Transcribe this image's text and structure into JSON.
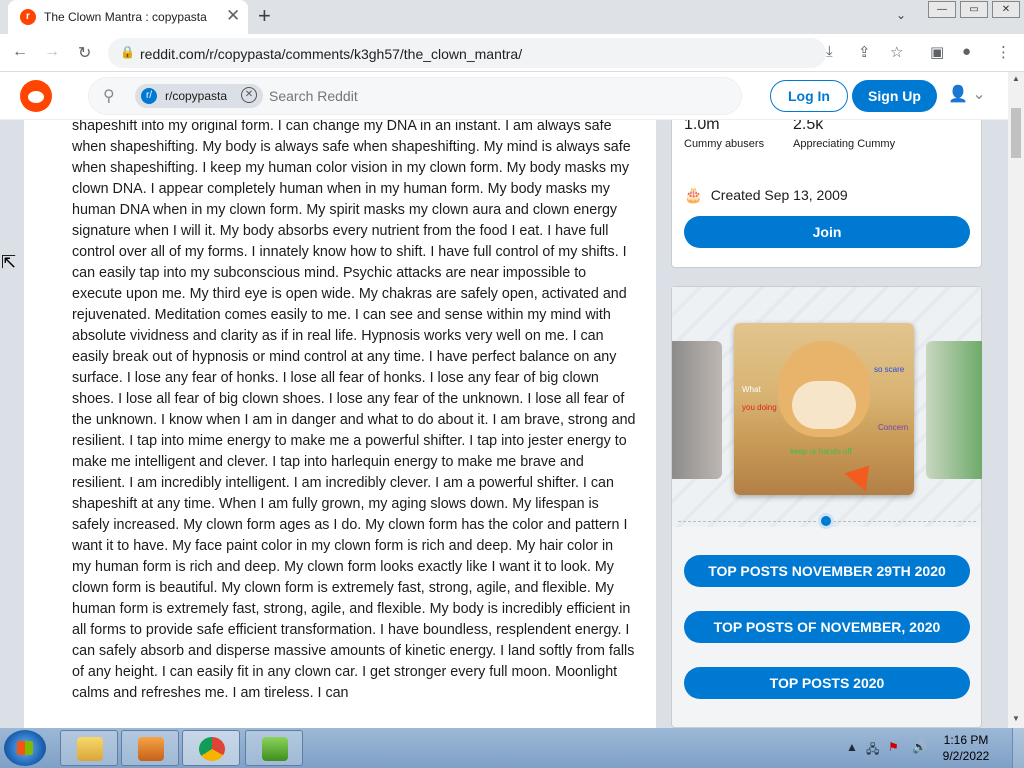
{
  "browser": {
    "tab_title": "The Clown Mantra : copypasta",
    "tab_close": "✕",
    "new_tab": "+",
    "tab_menu": "⌄",
    "url": "reddit.com/r/copypasta/comments/k3gh57/the_clown_mantra/"
  },
  "window": {
    "minimize": "—",
    "maximize": "▭",
    "close": "✕"
  },
  "reddit_header": {
    "subreddit_chip": "r/copypasta",
    "search_placeholder": "Search Reddit",
    "login_label": "Log In",
    "signup_label": "Sign Up"
  },
  "post": {
    "body": "shapeshift into my original form. I can change my DNA in an instant. I am always safe when shapeshifting. My body is always safe when shapeshifting. My mind is always safe when shapeshifting. I keep my human color vision in my clown form. My body masks my clown DNA. I appear completely human when in my human form. My body masks my human DNA when in my clown form. My spirit masks my clown aura and clown energy signature when I will it. My body absorbs every nutrient from the food I eat. I have full control over all of my forms. I innately know how to shift. I have full control of my shifts. I can easily tap into my subconscious mind. Psychic attacks are near impossible to execute upon me. My third eye is open wide. My chakras are safely open, activated and rejuvenated. Meditation comes easily to me. I can see and sense within my mind with absolute vividness and clarity as if in real life. Hypnosis works very well on me. I can easily break out of hypnosis or mind control at any time. I have perfect balance on any surface. I lose any fear of honks. I lose all fear of honks. I lose any fear of big clown shoes. I lose all fear of big clown shoes. I lose any fear of the unknown. I lose all fear of the unknown. I know when I am in danger and what to do about it. I am brave, strong and resilient. I tap into mime energy to make me a powerful shifter. I tap into jester energy to make me intelligent and clever. I tap into harlequin energy to make me brave and resilient. I am incredibly intelligent. I am incredibly clever. I am a powerful shifter. I can shapeshift at any time. When I am fully grown, my aging slows down. My lifespan is safely increased. My clown form ages as I do. My clown form has the color and pattern I want it to have. My face paint color in my clown form is rich and deep. My hair color in my human form is rich and deep. My clown form looks exactly like I want it to look. My clown form is beautiful. My clown form is extremely fast, strong, agile, and flexible. My human form is extremely fast, strong, agile, and flexible. My body is incredibly efficient in all forms to provide safe efficient transformation. I have boundless, resplendent energy. I can safely absorb and disperse massive amounts of kinetic energy. I land softly from falls of any height. I can easily fit in any clown car. I get stronger every full moon. Moonlight calms and refreshes me. I am tireless. I can"
  },
  "sidebar": {
    "members_count": "1.0m",
    "members_label": "Cummy abusers",
    "online_count": "2.5k",
    "online_label": "Appreciating Cummy",
    "created": "Created Sep 13, 2009",
    "join_label": "Join",
    "meme_text": {
      "what": "What",
      "you_doing": "you doing",
      "so_scare": "so scare",
      "concern": "Concern",
      "keep": "keep ur hands off"
    },
    "buttons": [
      "TOP POSTS NOVEMBER 29TH 2020",
      "TOP POSTS OF NOVEMBER, 2020",
      "TOP POSTS 2020"
    ]
  },
  "taskbar": {
    "time": "1:16 PM",
    "date": "9/2/2022",
    "tray_up": "▲"
  },
  "colors": {
    "reddit_orange": "#ff4500",
    "reddit_blue": "#0079d3",
    "page_bg": "#dae0e6"
  }
}
